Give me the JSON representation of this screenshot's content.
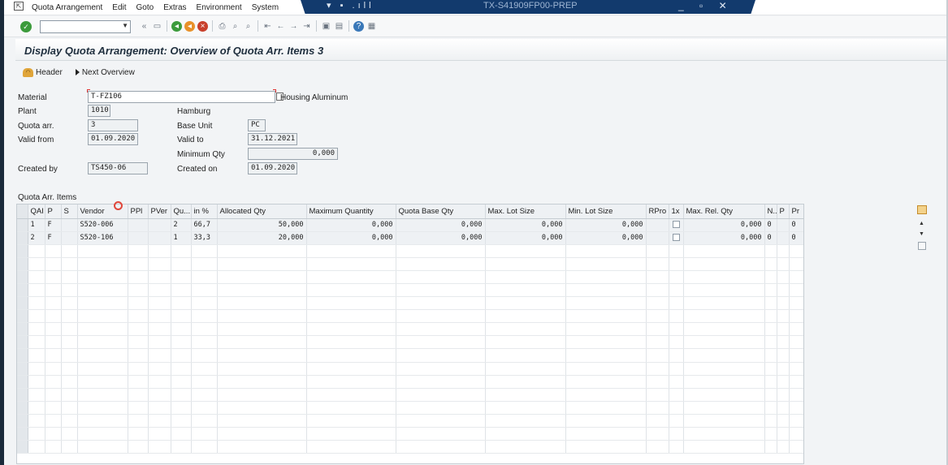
{
  "menu": {
    "items": [
      "Quota Arrangement",
      "Edit",
      "Goto",
      "Extras",
      "Environment",
      "System"
    ]
  },
  "window": {
    "title": "TX-S41909FP00-PREP",
    "left_controls": "▾ ▪ .ıll",
    "controls": "_ ▫ ✕"
  },
  "toolbar": {
    "command_value": "",
    "back_symbol": "«"
  },
  "page": {
    "title": "Display Quota Arrangement: Overview of Quota Arr. Items 3"
  },
  "apptoolbar": {
    "header_label": "Header",
    "next_overview_label": "Next Overview"
  },
  "header": {
    "material_label": "Material",
    "material_value": "T-FZ106",
    "material_desc": "Housing Aluminum",
    "plant_label": "Plant",
    "plant_value": "1010",
    "plant_name": "Hamburg",
    "quota_label": "Quota arr.",
    "quota_value": "3",
    "base_unit_label": "Base Unit",
    "base_unit_value": "PC",
    "valid_from_label": "Valid from",
    "valid_from_value": "01.09.2020",
    "valid_to_label": "Valid to",
    "valid_to_value": "31.12.2021",
    "min_qty_label": "Minimum Qty",
    "min_qty_value": "0,000",
    "created_by_label": "Created by",
    "created_by_value": "TS450-06",
    "created_on_label": "Created on",
    "created_on_value": "01.09.2020"
  },
  "table": {
    "caption": "Quota Arr. Items",
    "columns": [
      "QAI",
      "P",
      "S",
      "Vendor",
      "PPl",
      "PVer",
      "Qu...",
      "in %",
      "Allocated Qty",
      "Maximum Quantity",
      "Quota Base Qty",
      "Max. Lot Size",
      "Min. Lot Size",
      "RPro",
      "1x",
      "Max. Rel. Qty",
      "N..",
      "P",
      "Pr"
    ],
    "rows": [
      {
        "qai": "1",
        "p": "F",
        "s": "",
        "vendor": "S520-006",
        "ppl": "",
        "pver": "",
        "qu": "2",
        "pct": "66,7",
        "alloc": "50,000",
        "maxq": "0,000",
        "base": "0,000",
        "maxlot": "0,000",
        "minlot": "0,000",
        "rpro": "",
        "maxrel": "0,000",
        "n": "0",
        "p2": "",
        "pr": "0"
      },
      {
        "qai": "2",
        "p": "F",
        "s": "",
        "vendor": "S520-106",
        "ppl": "",
        "pver": "",
        "qu": "1",
        "pct": "33,3",
        "alloc": "20,000",
        "maxq": "0,000",
        "base": "0,000",
        "maxlot": "0,000",
        "minlot": "0,000",
        "rpro": "",
        "maxrel": "0,000",
        "n": "0",
        "p2": "",
        "pr": "0"
      }
    ],
    "empty_rows": 16
  },
  "colors": {
    "title_bar": "#123a6d",
    "ok_green": "#3c9b3c",
    "cursor_red": "#e0463a"
  }
}
